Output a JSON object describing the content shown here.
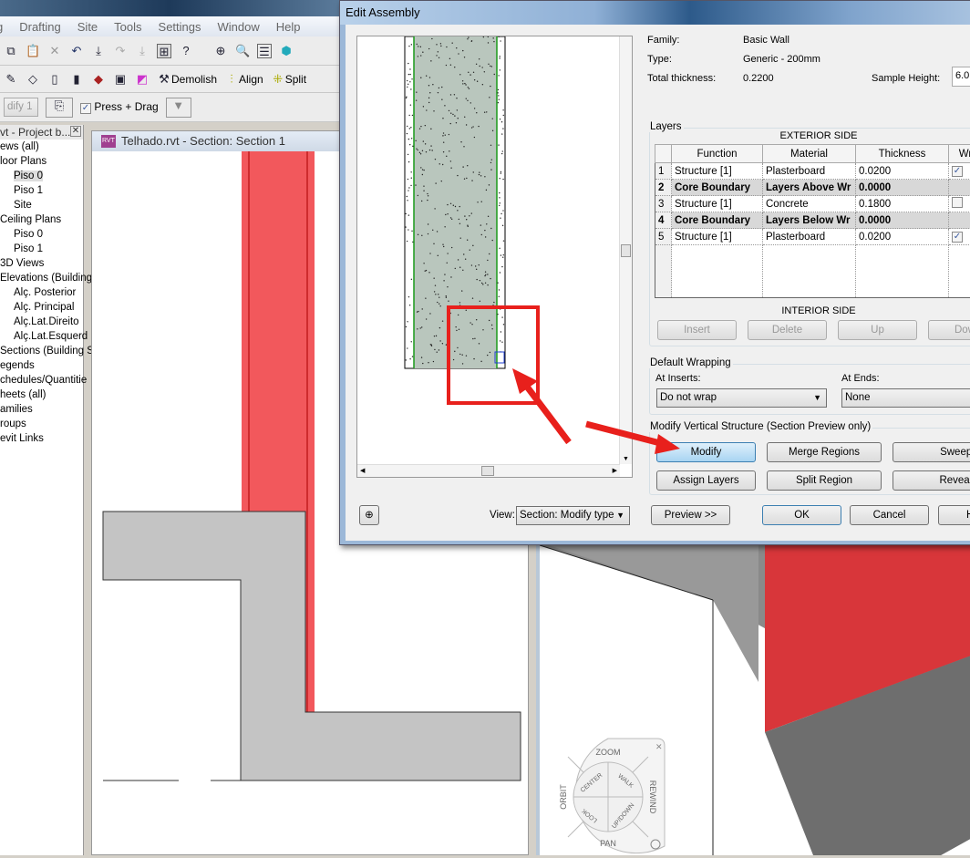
{
  "app": {
    "menu": [
      "g",
      "Drafting",
      "Site",
      "Tools",
      "Settings",
      "Window",
      "Help"
    ],
    "toolbar2": {
      "demolish": "Demolish",
      "align": "Align",
      "split": "Split"
    },
    "toolbar3": {
      "modify_select": "dify 1",
      "press_drag": "Press + Drag",
      "press_drag_checked": true
    }
  },
  "project_browser": {
    "title": "vt - Project b...",
    "items": [
      {
        "label": "ews (all)",
        "level": 0
      },
      {
        "label": "loor Plans",
        "level": 0
      },
      {
        "label": "Piso 0",
        "level": 1,
        "selected": true
      },
      {
        "label": "Piso 1",
        "level": 1
      },
      {
        "label": "Site",
        "level": 1
      },
      {
        "label": "Ceiling Plans",
        "level": 0
      },
      {
        "label": "Piso 0",
        "level": 1
      },
      {
        "label": "Piso 1",
        "level": 1
      },
      {
        "label": "3D Views",
        "level": 0
      },
      {
        "label": "Elevations (Building",
        "level": 0
      },
      {
        "label": "Alç. Posterior",
        "level": 1
      },
      {
        "label": "Alç. Principal",
        "level": 1
      },
      {
        "label": "Alç.Lat.Direito",
        "level": 1
      },
      {
        "label": "Alç.Lat.Esquerd",
        "level": 1
      },
      {
        "label": "Sections (Building S",
        "level": 0
      },
      {
        "label": "egends",
        "level": 0
      },
      {
        "label": "chedules/Quantitie",
        "level": 0
      },
      {
        "label": "heets (all)",
        "level": 0
      },
      {
        "label": "amilies",
        "level": 0
      },
      {
        "label": "roups",
        "level": 0
      },
      {
        "label": "evit Links",
        "level": 0
      }
    ]
  },
  "section_view": {
    "title": "Telhado.rvt - Section: Section 1",
    "badge": "RVT"
  },
  "dialog": {
    "title": "Edit Assembly",
    "family_label": "Family:",
    "family": "Basic Wall",
    "type_label": "Type:",
    "type": "Generic - 200mm",
    "thickness_label": "Total thickness:",
    "thickness": "0.2200",
    "sample_height_label": "Sample Height:",
    "sample_height": "6.0",
    "layers_legend": "Layers",
    "exterior": "EXTERIOR SIDE",
    "interior": "INTERIOR SIDE",
    "columns": [
      "",
      "Function",
      "Material",
      "Thickness",
      "Wr"
    ],
    "rows": [
      {
        "n": "1",
        "function": "Structure [1]",
        "material": "Plasterboard",
        "thickness": "0.0200",
        "wrap": true
      },
      {
        "n": "2",
        "function": "Core Boundary",
        "material": "Layers Above Wr",
        "thickness": "0.0000",
        "core": true
      },
      {
        "n": "3",
        "function": "Structure [1]",
        "material": "Concrete",
        "thickness": "0.1800",
        "wrap": false
      },
      {
        "n": "4",
        "function": "Core Boundary",
        "material": "Layers Below Wr",
        "thickness": "0.0000",
        "core": true
      },
      {
        "n": "5",
        "function": "Structure [1]",
        "material": "Plasterboard",
        "thickness": "0.0200",
        "wrap": true
      }
    ],
    "layer_buttons": [
      "Insert",
      "Delete",
      "Up",
      "Dow"
    ],
    "wrapping_legend": "Default Wrapping",
    "at_inserts_label": "At Inserts:",
    "at_inserts": "Do not wrap",
    "at_ends_label": "At  Ends:",
    "at_ends": "None",
    "vertical_legend": "Modify Vertical Structure (Section Preview only)",
    "vertical_buttons": [
      "Modify",
      "Merge Regions",
      "Sweeps",
      "Assign Layers",
      "Split Region",
      "Reveals"
    ],
    "view_label": "View:",
    "view": "Section: Modify type",
    "preview": "Preview >>",
    "ok": "OK",
    "cancel": "Cancel",
    "help": "H"
  },
  "steering_wheel": {
    "labels": [
      "ZOOM",
      "ORBIT",
      "REWIND",
      "PAN",
      "CENTER",
      "WALK",
      "LOOK",
      "UP/DOWN"
    ]
  },
  "colors": {
    "wall_red": "#f2585c",
    "concrete": "#b9c6bd",
    "highlight": "#e8201c"
  }
}
